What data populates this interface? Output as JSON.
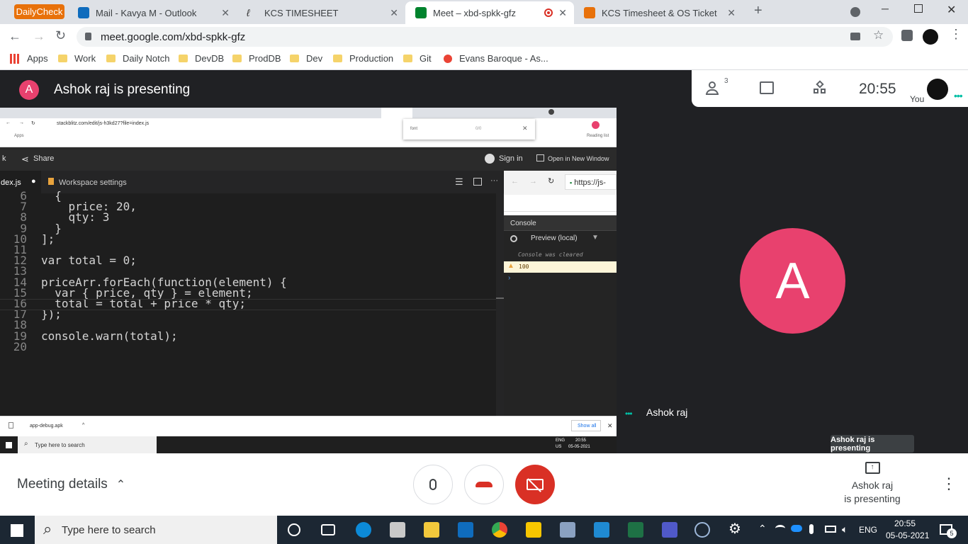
{
  "browser": {
    "tabs": [
      {
        "label": "DailyCheck"
      },
      {
        "label": "Mail - Kavya M - Outlook"
      },
      {
        "label": "KCS TIMESHEET"
      },
      {
        "label": "Meet – xbd-spkk-gfz"
      },
      {
        "label": "KCS Timesheet & OS Ticket"
      }
    ],
    "url": "meet.google.com/xbd-spkk-gfz",
    "bookmarks": [
      "Apps",
      "Work",
      "Daily Notch",
      "DevDB",
      "ProdDB",
      "Dev",
      "Production",
      "Git",
      "Evans Baroque - As..."
    ]
  },
  "meet": {
    "presenter_initial": "A",
    "presenter_title": "Ashok raj is presenting",
    "participant_count": "3",
    "time": "20:55",
    "you_label": "You",
    "participant_initial": "A",
    "participant_name": "Ashok raj",
    "tooltip": "Ashok raj is presenting",
    "meeting_details": "Meeting details",
    "presenting_line1": "Ashok raj",
    "presenting_line2": "is presenting"
  },
  "shared": {
    "url": "stackblitz.com/edit/js-h3kd27?file=index.js",
    "apps_label": "Apps",
    "reading_list": "Reading list",
    "find_text": "font",
    "find_count": "0/0",
    "share_label": "Share",
    "sign_in": "Sign in",
    "open_new_window": "Open in New Window",
    "file_tab": "dex.js",
    "workspace_tab": "Workspace settings",
    "preview_url": "https://js-",
    "console_tab": "Console",
    "preview_select": "Preview (local)",
    "console_cleared": "Console was cleared",
    "console_warn": "100",
    "download_file": "app-debug.apk",
    "show_all": "Show all",
    "inner_search": "Type here to search",
    "inner_lang": "ENG",
    "inner_region": "US",
    "inner_time": "20:55",
    "inner_date": "05-05-2021",
    "code_lines": [
      {
        "n": "6",
        "t": "  {"
      },
      {
        "n": "7",
        "t": "    price: 20,"
      },
      {
        "n": "8",
        "t": "    qty: 3"
      },
      {
        "n": "9",
        "t": "  }"
      },
      {
        "n": "10",
        "t": "];"
      },
      {
        "n": "11",
        "t": ""
      },
      {
        "n": "12",
        "t": "var total = 0;"
      },
      {
        "n": "13",
        "t": ""
      },
      {
        "n": "14",
        "t": "priceArr.forEach(function(element) {"
      },
      {
        "n": "15",
        "t": "  var { price, qty } = element;"
      },
      {
        "n": "16",
        "t": "  total = total + price * qty;"
      },
      {
        "n": "17",
        "t": "});"
      },
      {
        "n": "18",
        "t": ""
      },
      {
        "n": "19",
        "t": "console.warn(total);"
      },
      {
        "n": "20",
        "t": ""
      }
    ]
  },
  "taskbar": {
    "search_placeholder": "Type here to search",
    "lang": "ENG",
    "time": "20:55",
    "date": "05-05-2021",
    "notification_count": "5"
  }
}
